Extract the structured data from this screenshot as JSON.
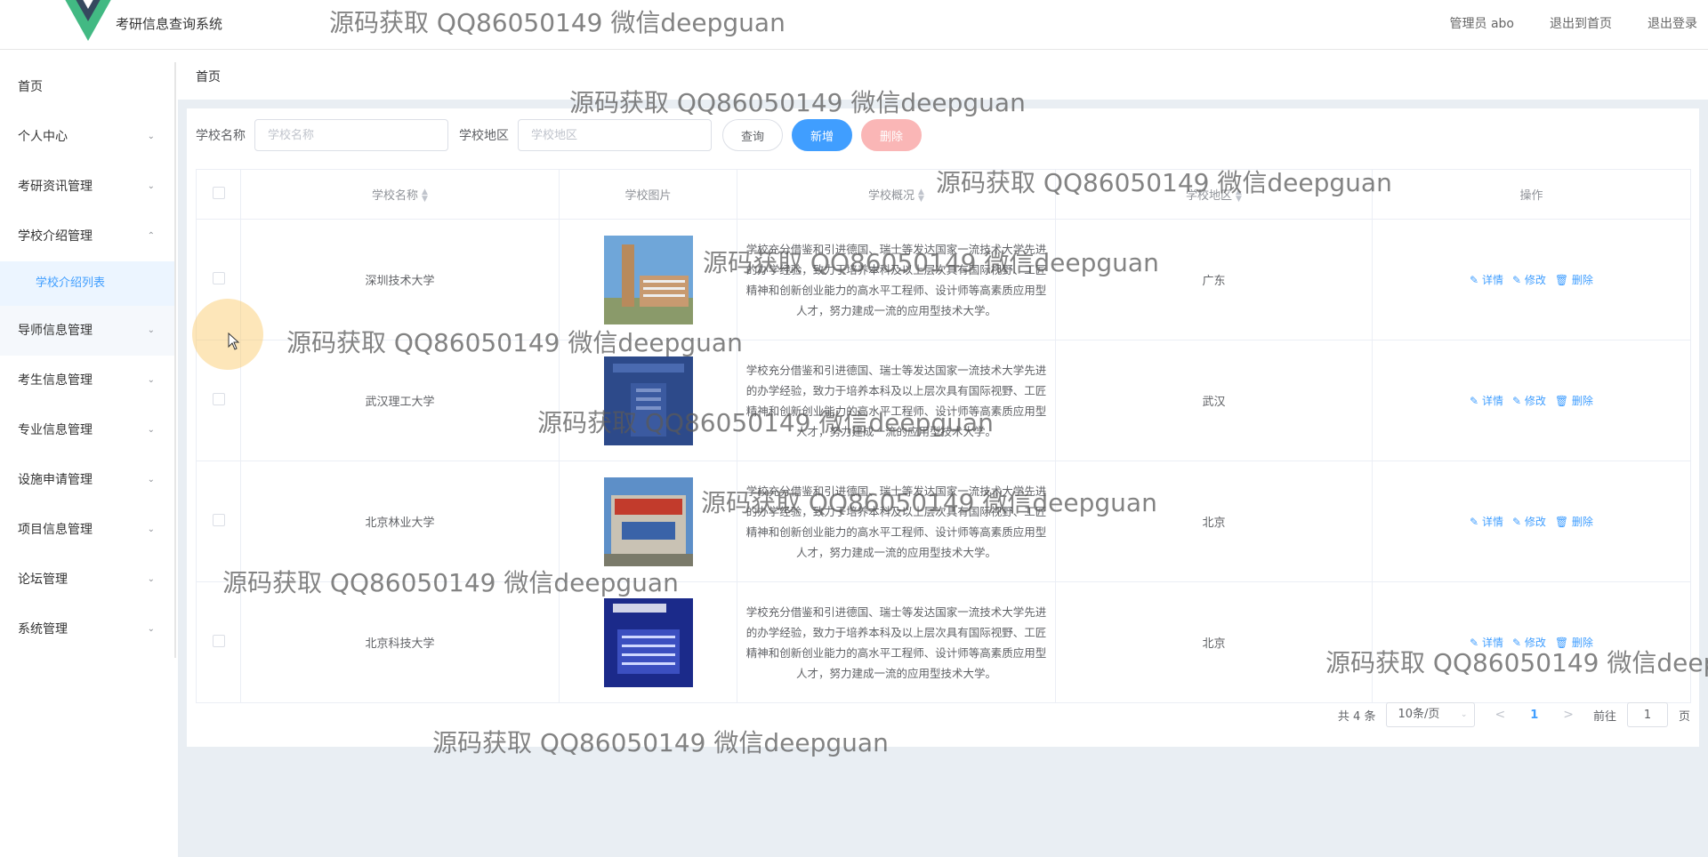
{
  "header": {
    "title": "考研信息查询系统",
    "links": [
      "管理员 abo",
      "退出到首页",
      "退出登录"
    ]
  },
  "sidebar": {
    "items": [
      {
        "label": "首页",
        "has_chevron": false
      },
      {
        "label": "个人中心",
        "has_chevron": true
      },
      {
        "label": "考研资讯管理",
        "has_chevron": true
      },
      {
        "label": "学校介绍管理",
        "has_chevron": true,
        "expanded": true,
        "children": [
          "学校介绍列表"
        ]
      },
      {
        "label": "导师信息管理",
        "has_chevron": true
      },
      {
        "label": "考生信息管理",
        "has_chevron": true
      },
      {
        "label": "专业信息管理",
        "has_chevron": true
      },
      {
        "label": "设施申请管理",
        "has_chevron": true
      },
      {
        "label": "项目信息管理",
        "has_chevron": true
      },
      {
        "label": "论坛管理",
        "has_chevron": true
      },
      {
        "label": "系统管理",
        "has_chevron": true
      }
    ]
  },
  "breadcrumb": "首页",
  "search": {
    "name_label": "学校名称",
    "name_placeholder": "学校名称",
    "region_label": "学校地区",
    "region_placeholder": "学校地区",
    "query_button": "查询",
    "add_button": "新增",
    "delete_button": "删除"
  },
  "table": {
    "headers": [
      "学校名称",
      "学校图片",
      "学校概况",
      "学校地区",
      "操作"
    ],
    "rows": [
      {
        "name": "深圳技术大学",
        "overview": "学校充分借鉴和引进德国、瑞士等发达国家一流技术大学先进的办学经验，致力于培养本科及以上层次具有国际视野、工匠精神和创新创业能力的高水平工程师、设计师等高素质应用型人才，努力建成一流的应用型技术大学。",
        "region": "广东"
      },
      {
        "name": "武汉理工大学",
        "overview": "学校充分借鉴和引进德国、瑞士等发达国家一流技术大学先进的办学经验，致力于培养本科及以上层次具有国际视野、工匠精神和创新创业能力的高水平工程师、设计师等高素质应用型人才，努力建成一流的应用型技术大学。",
        "region": "武汉"
      },
      {
        "name": "北京林业大学",
        "overview": "学校充分借鉴和引进德国、瑞士等发达国家一流技术大学先进的办学经验，致力于培养本科及以上层次具有国际视野、工匠精神和创新创业能力的高水平工程师、设计师等高素质应用型人才，努力建成一流的应用型技术大学。",
        "region": "北京"
      },
      {
        "name": "北京科技大学",
        "overview": "学校充分借鉴和引进德国、瑞士等发达国家一流技术大学先进的办学经验，致力于培养本科及以上层次具有国际视野、工匠精神和创新创业能力的高水平工程师、设计师等高素质应用型人才，努力建成一流的应用型技术大学。",
        "region": "北京"
      }
    ],
    "actions": [
      "详情",
      "修改",
      "删除"
    ]
  },
  "pagination": {
    "total": "共 4 条",
    "page_size": "10条/页",
    "current": "1",
    "goto_label": "前往",
    "goto_value": "1",
    "page_suffix": "页"
  },
  "watermark": "源码获取 QQ86050149 微信deepguan",
  "colors": {
    "primary": "#409eff",
    "danger_disabled": "#fab6b6",
    "logo_green": "#42b983",
    "logo_dark": "#35495e"
  }
}
